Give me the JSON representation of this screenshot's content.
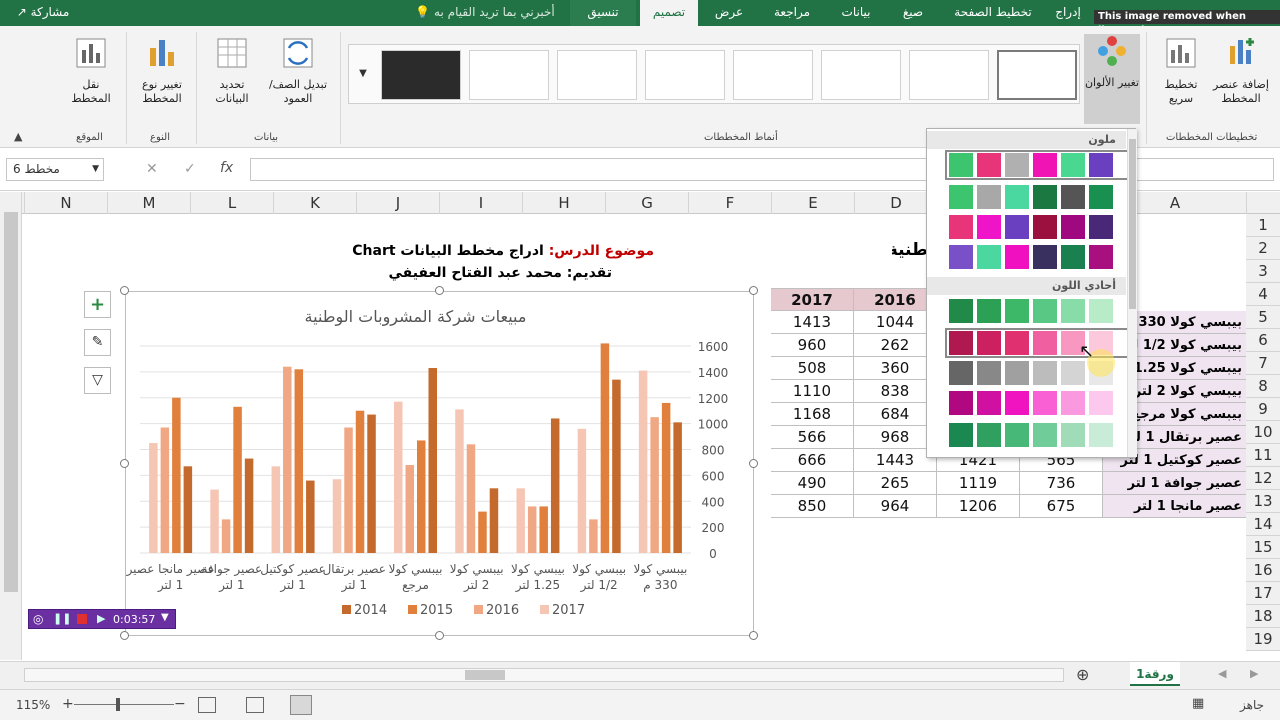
{
  "tabs": [
    {
      "label": "إدراج"
    },
    {
      "label": "تخطيط الصفحة"
    },
    {
      "label": "صيغ"
    },
    {
      "label": "بيانات"
    },
    {
      "label": "مراجعة"
    },
    {
      "label": "عرض"
    },
    {
      "label": "تصميم"
    },
    {
      "label": "تنسيق"
    }
  ],
  "tell_me": "أخبرني بما تريد القيام به",
  "share": "مشاركة",
  "watermark": "This image removed when licensed",
  "ribbon": {
    "add_element": "إضافة عنصر المخطط",
    "quick_layout": "تخطيط سريع",
    "change_colors": "تغيير الألوان",
    "group_layouts": "تخطيطات المخططات",
    "group_styles": "أنماط المخططات",
    "switch_row_col": "تبديل الصف/ العمود",
    "select_data": "تحديد البيانات",
    "group_data": "بيانات",
    "change_type": "تغيير نوع المخطط",
    "group_type": "النوع",
    "move_chart": "نقل المخطط",
    "group_location": "الموقع"
  },
  "formula_bar": {
    "name_box": "مخطط 6",
    "fx": "fx"
  },
  "columns": [
    "N",
    "M",
    "L",
    "K",
    "J",
    "I",
    "H",
    "G",
    "F",
    "E",
    "D",
    "C",
    "B",
    "A"
  ],
  "rows": [
    "1",
    "2",
    "3",
    "4",
    "5",
    "6",
    "7",
    "8",
    "9",
    "10",
    "11",
    "12",
    "13",
    "14",
    "15",
    "16",
    "17",
    "18",
    "19"
  ],
  "sheet": {
    "lesson_label": "موضوع الدرس:",
    "lesson_title": "ادراج مخطط البيانات Chart",
    "presenter": "تقديم: محمد عبد الفتاح العفيفي",
    "title_fragment": "طنية",
    "header_2016": "2016",
    "header_2017": "2017"
  },
  "table": [
    {
      "name": "بيبسي كولا 330 م",
      "d": "1044",
      "e": "1413"
    },
    {
      "name": "بيبسي كولا 1/2 لتر",
      "d": "262",
      "e": "960"
    },
    {
      "name": "بيبسي كولا 1.25 لتر",
      "d": "360",
      "e": "508"
    },
    {
      "name": "بيبسي كولا 2 لتر",
      "d": "838",
      "e": "1110"
    },
    {
      "name": "بيبسي كولا مرجع",
      "d": "684",
      "e": "1168"
    },
    {
      "name": "عصير برتقال 1 لتر",
      "d": "968",
      "e": "566"
    },
    {
      "name": "عصير كوكتيل 1 لتر",
      "c": "1421",
      "b": "565",
      "d": "1443",
      "e": "666"
    },
    {
      "name": "عصير جوافة 1 لتر",
      "c": "1119",
      "b": "736",
      "d": "265",
      "e": "490"
    },
    {
      "name": "عصير مانجا 1 لتر",
      "c": "1206",
      "b": "675",
      "d": "964",
      "e": "850"
    }
  ],
  "palette": {
    "section_colorful": "ملون",
    "section_mono": "أحادي اللون"
  },
  "video": {
    "time": "0:03:57"
  },
  "sheet_tab": "ورقة1",
  "status": {
    "ready": "جاهز",
    "zoom": "115%"
  },
  "chart_data": {
    "type": "bar",
    "title": "مبيعات شركة المشروبات الوطنية",
    "categories": [
      "بيبسي كولا 330 م",
      "بيبسي كولا 1/2 لتر",
      "بيبسي كولا 1.25 لتر",
      "بيبسي كولا 2 لتر",
      "بيبسي كولا مرجع",
      "عصير برتقال 1 لتر",
      "عصير كوكتيل 1 لتر",
      "عصير جوافة 1 لتر",
      "عصير مانجا عصير 1 لتر"
    ],
    "series": [
      {
        "name": "2014",
        "values": [
          1010,
          1340,
          1040,
          500,
          1430,
          1070,
          560,
          730,
          670
        ]
      },
      {
        "name": "2015",
        "values": [
          1160,
          1620,
          360,
          320,
          870,
          1100,
          1420,
          1130,
          1200
        ]
      },
      {
        "name": "2016",
        "values": [
          1050,
          260,
          360,
          840,
          680,
          970,
          1440,
          260,
          970
        ]
      },
      {
        "name": "2017",
        "values": [
          1410,
          960,
          500,
          1110,
          1170,
          570,
          670,
          490,
          850
        ]
      }
    ],
    "yticks": [
      "0",
      "200",
      "400",
      "600",
      "800",
      "1000",
      "1200",
      "1400",
      "1600"
    ],
    "ylim": [
      0,
      1600
    ],
    "legend": "bottom",
    "colors": {
      "2014": "#c46a2c",
      "2015": "#e0803c",
      "2016": "#f0a884",
      "2017": "#f6c6b4"
    }
  }
}
